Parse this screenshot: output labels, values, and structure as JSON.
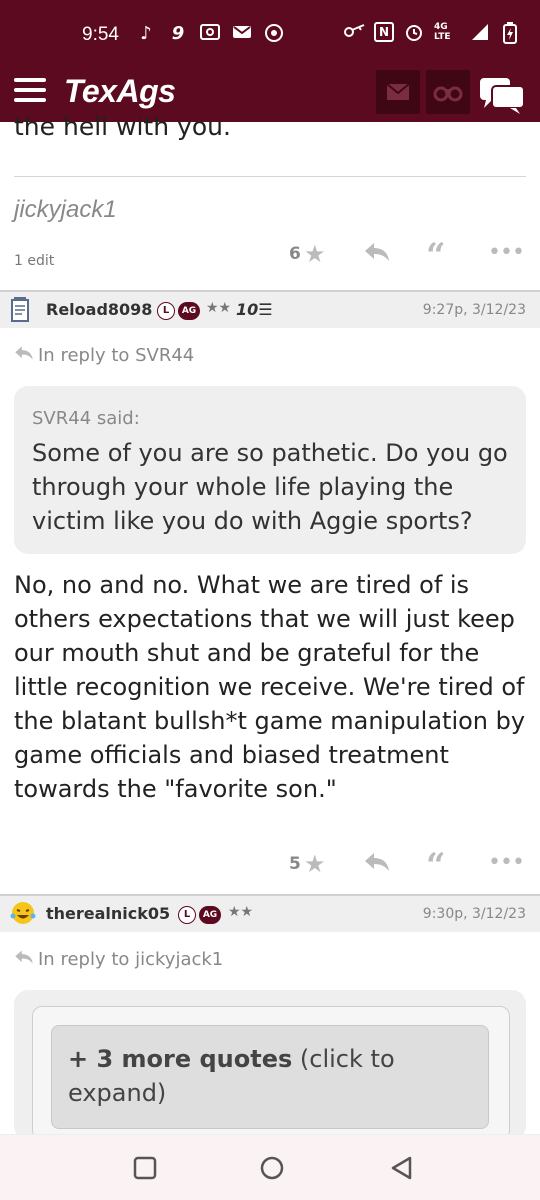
{
  "status_bar": {
    "time": "9:54",
    "network": "4G LTE",
    "left_icons": [
      "tiktok-icon",
      "nine-icon",
      "radio-icon",
      "mail-icon",
      "chrome-icon"
    ],
    "right_icons": [
      "key-icon",
      "nfc-icon",
      "alarm-icon",
      "signal-icon",
      "battery-icon"
    ]
  },
  "header": {
    "logo": "TexAgs"
  },
  "previous_post": {
    "text_tail": "the hell with you.",
    "signature": "jickyjack1",
    "edit_note": "1 edit",
    "stars": "6"
  },
  "posts": [
    {
      "username": "Reload8098",
      "badge_l": "L",
      "badge_ag": "AG",
      "stars": "★★",
      "tenure": "10☰",
      "timestamp": "9:27p, 3/12/23",
      "in_reply_to": "In reply to SVR44",
      "quote_said": "SVR44 said:",
      "quote_text": "Some of you are so pathetic. Do you go through your whole life playing the victim like you do with Aggie sports?",
      "body": "No, no and no. What we are tired of is others expectations that we will just keep our mouth shut and be grateful for the little recognition we receive. We're tired of the blatant bullsh*t game manipulation by game officials and biased treatment towards the \"favorite son.\"",
      "star_count": "5"
    },
    {
      "username": "therealnick05",
      "badge_l": "L",
      "badge_ag": "AG",
      "stars": "★★",
      "timestamp": "9:30p, 3/12/23",
      "in_reply_to": "In reply to jickyjack1",
      "more_quotes_bold": "+ 3 more quotes",
      "more_quotes_rest": " (click to expand)"
    }
  ],
  "colors": {
    "brand_maroon": "#5b0a1f",
    "header_button": "#3f0714",
    "quote_bg": "#efefef"
  }
}
